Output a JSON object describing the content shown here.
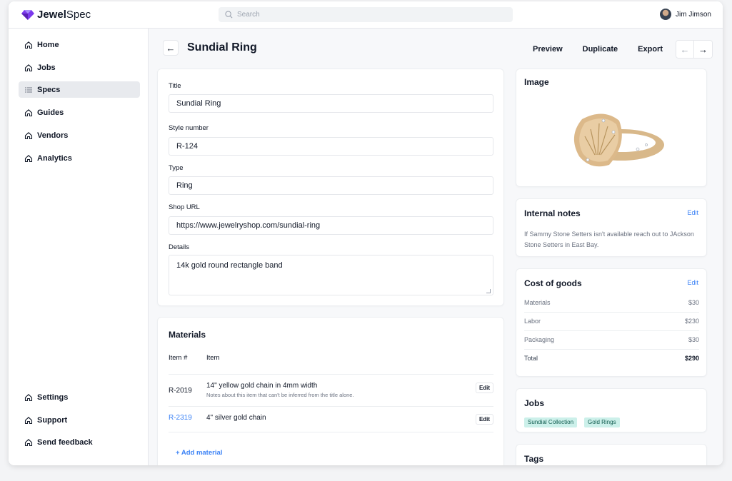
{
  "header": {
    "logo_bold": "Jewel",
    "logo_rest": "Spec",
    "search_placeholder": "Search",
    "user_name": "Jim Jimson"
  },
  "sidebar": {
    "items": [
      {
        "label": "Home"
      },
      {
        "label": "Jobs"
      },
      {
        "label": "Specs",
        "active": true
      },
      {
        "label": "Guides"
      },
      {
        "label": "Vendors"
      },
      {
        "label": "Analytics"
      }
    ],
    "footer_items": [
      {
        "label": "Settings"
      },
      {
        "label": "Support"
      },
      {
        "label": "Send feedback"
      }
    ]
  },
  "page": {
    "title": "Sundial Ring",
    "actions": {
      "preview": "Preview",
      "duplicate": "Duplicate",
      "export": "Export"
    }
  },
  "form": {
    "title_label": "Title",
    "title_value": "Sundial Ring",
    "style_label": "Style number",
    "style_value": "R-124",
    "type_label": "Type",
    "type_value": "Ring",
    "url_label": "Shop URL",
    "url_value": "https://www.jewelryshop.com/sundial-ring",
    "details_label": "Details",
    "details_value": "14k gold round rectangle band"
  },
  "materials": {
    "title": "Materials",
    "col_item_no": "Item #",
    "col_item": "Item",
    "rows": [
      {
        "id": "R-2019",
        "title": "14\" yellow gold chain in 4mm width",
        "note": "Notes about this item that can't be inferred from the title alone.",
        "edit": "Edit"
      },
      {
        "id": "R-2319",
        "title": "4\" silver gold chain",
        "note": "",
        "edit": "Edit"
      }
    ],
    "add_label": "+ Add material"
  },
  "image_card": {
    "title": "Image"
  },
  "notes": {
    "title": "Internal notes",
    "edit": "Edit",
    "text": "If Sammy Stone Setters isn't available reach out to JAckson Stone Setters in East Bay."
  },
  "cost": {
    "title": "Cost of goods",
    "edit": "Edit",
    "rows": [
      {
        "label": "Materials",
        "value": "$30"
      },
      {
        "label": "Labor",
        "value": "$230"
      },
      {
        "label": "Packaging",
        "value": "$30"
      },
      {
        "label": "Total",
        "value": "$290"
      }
    ]
  },
  "jobs": {
    "title": "Jobs",
    "tags": [
      "Sundial Collection",
      "Gold Rings"
    ]
  },
  "tags": {
    "title": "Tags"
  },
  "colors": {
    "accent": "#3b82f6",
    "tag_bg": "#ccf0ea",
    "logo_purple": "#7c3aed"
  }
}
